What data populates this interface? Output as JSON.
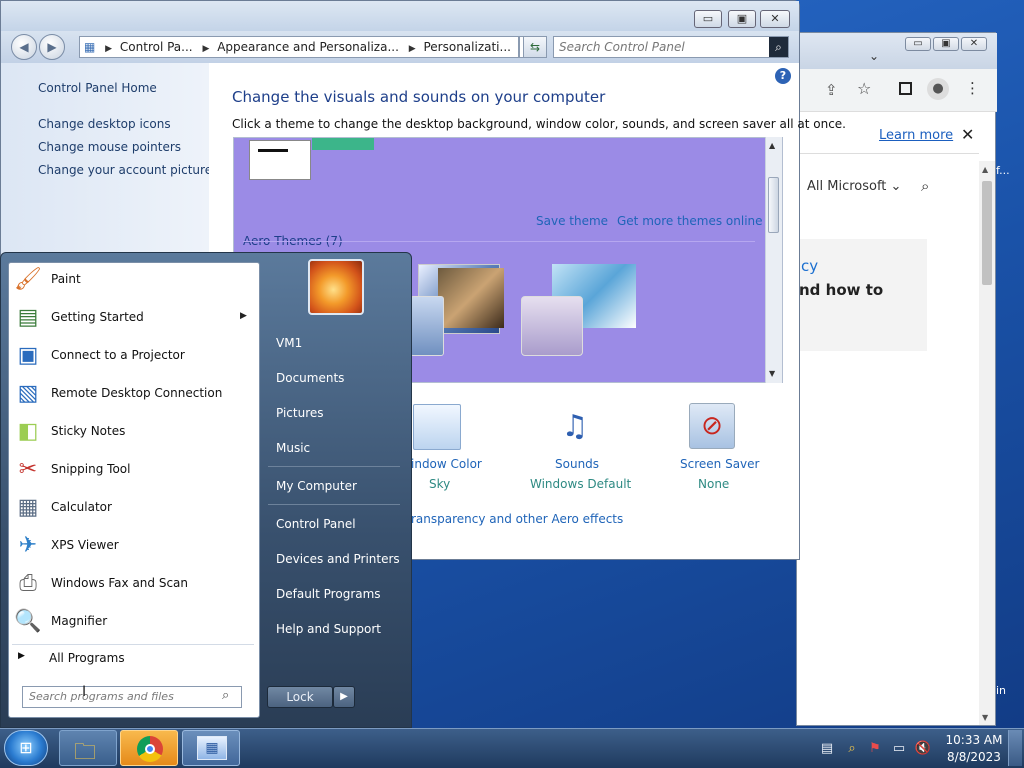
{
  "control_panel": {
    "breadcrumb": [
      "Control Pa...",
      "Appearance and Personaliza...",
      "Personalizati..."
    ],
    "search_placeholder": "Search Control Panel",
    "sidebar": {
      "home": "Control Panel Home",
      "links": [
        "Change desktop icons",
        "Change mouse pointers",
        "Change your account picture"
      ]
    },
    "heading": "Change the visuals and sounds on your computer",
    "subheading": "Click a theme to change the desktop background, window color, sounds, and screen saver all at once.",
    "save_theme": "Save theme",
    "more_themes": "Get more themes online",
    "aero_themes": "Aero Themes (7)",
    "bottom_items": [
      {
        "label": "indow Color",
        "value": "Sky",
        "icon": "window-color-icon"
      },
      {
        "label": "Sounds",
        "value": "Windows Default",
        "icon": "sounds-icon"
      },
      {
        "label": "Screen Saver",
        "value": "None",
        "icon": "screen-saver-icon"
      }
    ],
    "aero_link": "ransparency and other Aero effects",
    "window_buttons": {
      "minimize": "▭",
      "maximize": "▣",
      "close": "✕"
    }
  },
  "chrome": {
    "learn_more": "Learn more",
    "all_microsoft": "All Microsoft",
    "text_fragments": [
      "cy",
      "nd how to"
    ],
    "edge_text_f": "f...",
    "edge_text_in": "in"
  },
  "start_menu": {
    "programs": [
      {
        "label": "Paint",
        "icon": "paint-icon"
      },
      {
        "label": "Getting Started",
        "icon": "getting-started-icon",
        "submenu": true
      },
      {
        "label": "Connect to a Projector",
        "icon": "projector-icon"
      },
      {
        "label": "Remote Desktop Connection",
        "icon": "remote-desktop-icon"
      },
      {
        "label": "Sticky Notes",
        "icon": "sticky-notes-icon"
      },
      {
        "label": "Snipping Tool",
        "icon": "snipping-tool-icon"
      },
      {
        "label": "Calculator",
        "icon": "calculator-icon"
      },
      {
        "label": "XPS Viewer",
        "icon": "xps-viewer-icon"
      },
      {
        "label": "Windows Fax and Scan",
        "icon": "fax-scan-icon"
      },
      {
        "label": "Magnifier",
        "icon": "magnifier-icon"
      }
    ],
    "all_programs": "All Programs",
    "search_placeholder": "Search programs and files",
    "right_items": [
      "VM1",
      "Documents",
      "Pictures",
      "Music",
      "My Computer",
      "Control Panel",
      "Devices and Printers",
      "Default Programs",
      "Help and Support"
    ],
    "lock": "Lock"
  },
  "taskbar": {
    "time": "10:33 AM",
    "date": "8/8/2023"
  }
}
